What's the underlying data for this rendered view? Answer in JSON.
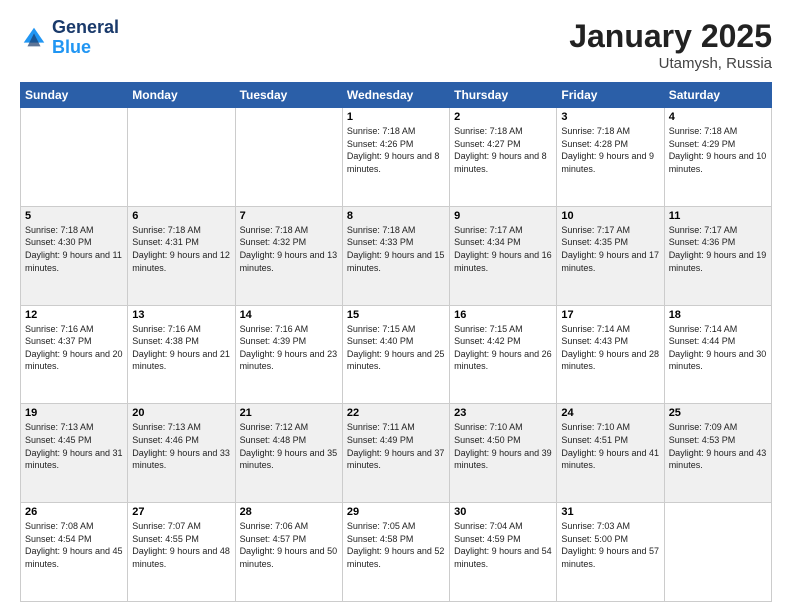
{
  "header": {
    "logo_line1": "General",
    "logo_line2": "Blue",
    "month": "January 2025",
    "location": "Utamysh, Russia"
  },
  "days_of_week": [
    "Sunday",
    "Monday",
    "Tuesday",
    "Wednesday",
    "Thursday",
    "Friday",
    "Saturday"
  ],
  "weeks": [
    [
      {
        "day": "",
        "sunrise": "",
        "sunset": "",
        "daylight": ""
      },
      {
        "day": "",
        "sunrise": "",
        "sunset": "",
        "daylight": ""
      },
      {
        "day": "",
        "sunrise": "",
        "sunset": "",
        "daylight": ""
      },
      {
        "day": "1",
        "sunrise": "7:18 AM",
        "sunset": "4:26 PM",
        "daylight": "9 hours and 8 minutes."
      },
      {
        "day": "2",
        "sunrise": "7:18 AM",
        "sunset": "4:27 PM",
        "daylight": "9 hours and 8 minutes."
      },
      {
        "day": "3",
        "sunrise": "7:18 AM",
        "sunset": "4:28 PM",
        "daylight": "9 hours and 9 minutes."
      },
      {
        "day": "4",
        "sunrise": "7:18 AM",
        "sunset": "4:29 PM",
        "daylight": "9 hours and 10 minutes."
      }
    ],
    [
      {
        "day": "5",
        "sunrise": "7:18 AM",
        "sunset": "4:30 PM",
        "daylight": "9 hours and 11 minutes."
      },
      {
        "day": "6",
        "sunrise": "7:18 AM",
        "sunset": "4:31 PM",
        "daylight": "9 hours and 12 minutes."
      },
      {
        "day": "7",
        "sunrise": "7:18 AM",
        "sunset": "4:32 PM",
        "daylight": "9 hours and 13 minutes."
      },
      {
        "day": "8",
        "sunrise": "7:18 AM",
        "sunset": "4:33 PM",
        "daylight": "9 hours and 15 minutes."
      },
      {
        "day": "9",
        "sunrise": "7:17 AM",
        "sunset": "4:34 PM",
        "daylight": "9 hours and 16 minutes."
      },
      {
        "day": "10",
        "sunrise": "7:17 AM",
        "sunset": "4:35 PM",
        "daylight": "9 hours and 17 minutes."
      },
      {
        "day": "11",
        "sunrise": "7:17 AM",
        "sunset": "4:36 PM",
        "daylight": "9 hours and 19 minutes."
      }
    ],
    [
      {
        "day": "12",
        "sunrise": "7:16 AM",
        "sunset": "4:37 PM",
        "daylight": "9 hours and 20 minutes."
      },
      {
        "day": "13",
        "sunrise": "7:16 AM",
        "sunset": "4:38 PM",
        "daylight": "9 hours and 21 minutes."
      },
      {
        "day": "14",
        "sunrise": "7:16 AM",
        "sunset": "4:39 PM",
        "daylight": "9 hours and 23 minutes."
      },
      {
        "day": "15",
        "sunrise": "7:15 AM",
        "sunset": "4:40 PM",
        "daylight": "9 hours and 25 minutes."
      },
      {
        "day": "16",
        "sunrise": "7:15 AM",
        "sunset": "4:42 PM",
        "daylight": "9 hours and 26 minutes."
      },
      {
        "day": "17",
        "sunrise": "7:14 AM",
        "sunset": "4:43 PM",
        "daylight": "9 hours and 28 minutes."
      },
      {
        "day": "18",
        "sunrise": "7:14 AM",
        "sunset": "4:44 PM",
        "daylight": "9 hours and 30 minutes."
      }
    ],
    [
      {
        "day": "19",
        "sunrise": "7:13 AM",
        "sunset": "4:45 PM",
        "daylight": "9 hours and 31 minutes."
      },
      {
        "day": "20",
        "sunrise": "7:13 AM",
        "sunset": "4:46 PM",
        "daylight": "9 hours and 33 minutes."
      },
      {
        "day": "21",
        "sunrise": "7:12 AM",
        "sunset": "4:48 PM",
        "daylight": "9 hours and 35 minutes."
      },
      {
        "day": "22",
        "sunrise": "7:11 AM",
        "sunset": "4:49 PM",
        "daylight": "9 hours and 37 minutes."
      },
      {
        "day": "23",
        "sunrise": "7:10 AM",
        "sunset": "4:50 PM",
        "daylight": "9 hours and 39 minutes."
      },
      {
        "day": "24",
        "sunrise": "7:10 AM",
        "sunset": "4:51 PM",
        "daylight": "9 hours and 41 minutes."
      },
      {
        "day": "25",
        "sunrise": "7:09 AM",
        "sunset": "4:53 PM",
        "daylight": "9 hours and 43 minutes."
      }
    ],
    [
      {
        "day": "26",
        "sunrise": "7:08 AM",
        "sunset": "4:54 PM",
        "daylight": "9 hours and 45 minutes."
      },
      {
        "day": "27",
        "sunrise": "7:07 AM",
        "sunset": "4:55 PM",
        "daylight": "9 hours and 48 minutes."
      },
      {
        "day": "28",
        "sunrise": "7:06 AM",
        "sunset": "4:57 PM",
        "daylight": "9 hours and 50 minutes."
      },
      {
        "day": "29",
        "sunrise": "7:05 AM",
        "sunset": "4:58 PM",
        "daylight": "9 hours and 52 minutes."
      },
      {
        "day": "30",
        "sunrise": "7:04 AM",
        "sunset": "4:59 PM",
        "daylight": "9 hours and 54 minutes."
      },
      {
        "day": "31",
        "sunrise": "7:03 AM",
        "sunset": "5:00 PM",
        "daylight": "9 hours and 57 minutes."
      },
      {
        "day": "",
        "sunrise": "",
        "sunset": "",
        "daylight": ""
      }
    ]
  ]
}
